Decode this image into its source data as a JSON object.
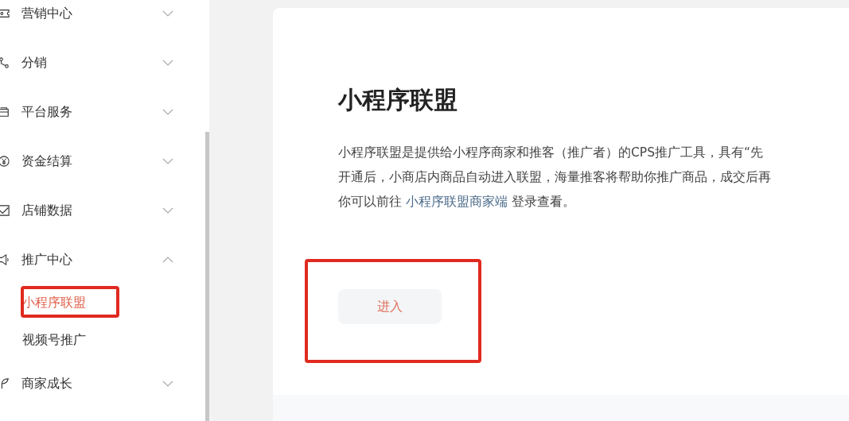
{
  "sidebar": {
    "items": [
      {
        "label": "营销中心",
        "expanded": false
      },
      {
        "label": "分销",
        "expanded": false
      },
      {
        "label": "平台服务",
        "expanded": false
      },
      {
        "label": "资金结算",
        "expanded": false
      },
      {
        "label": "店铺数据",
        "expanded": false
      },
      {
        "label": "推广中心",
        "expanded": true,
        "children": [
          {
            "label": "小程序联盟",
            "selected": true
          },
          {
            "label": "视频号推广",
            "selected": false
          }
        ]
      },
      {
        "label": "商家成长",
        "expanded": false
      }
    ]
  },
  "page": {
    "title": "小程序联盟",
    "lines": [
      "小程序联盟是提供给小程序商家和推客（推广者）的CPS推广工具，具有“先",
      "开通后，小商店内商品自动进入联盟，海量推客将帮助你推广商品，成交后再"
    ],
    "link_prefix": "你可以前往 ",
    "link": "小程序联盟商家端",
    "link_suffix": " 登录查看。",
    "button": "进入"
  }
}
